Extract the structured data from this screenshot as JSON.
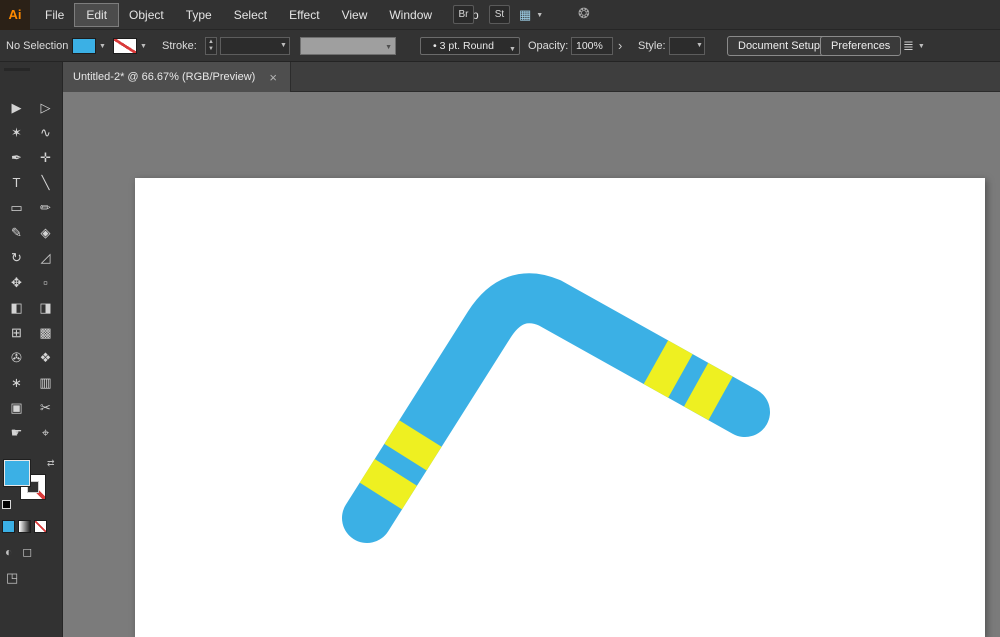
{
  "colors": {
    "panel": "#323232",
    "tab_strip": "#3e3e3e",
    "tab_bg": "#4e4e4e",
    "canvas": "#7b7b7b",
    "artboard": "#ffffff",
    "accent_blue": "#3BB0E5",
    "stripe_yellow": "#EEF021",
    "none_red": "#D93A3A",
    "logo_orange": "#FF8A00"
  },
  "menu": {
    "logo": "Ai",
    "items": [
      "File",
      "Edit",
      "Object",
      "Type",
      "Select",
      "Effect",
      "View",
      "Window",
      "Help"
    ],
    "active_item": "Edit",
    "br_button": "Br",
    "st_button": "St"
  },
  "control": {
    "selection_status": "No Selection",
    "stroke_label": "Stroke:",
    "brush_bullet": "•",
    "brush_value": "3 pt. Round",
    "opacity_label": "Opacity:",
    "opacity_value": "100%",
    "opacity_more": "›",
    "style_label": "Style:",
    "document_setup_button": "Document Setup",
    "preferences_button": "Preferences"
  },
  "tab": {
    "title": "Untitled-2* @ 66.67% (RGB/Preview)",
    "close_glyph": "×"
  },
  "icons": {
    "dropdown": "▼",
    "stepper_up": "▲",
    "stepper_down": "▼",
    "workspace": "▦",
    "extra": "❂",
    "align": "≣",
    "swap": "⇄",
    "draw_mode_a": "◐",
    "draw_mode_b": "◻",
    "screen_mode": "◳"
  },
  "toolbar": {
    "tools": [
      {
        "name": "selection-tool-icon",
        "glyph": "▶"
      },
      {
        "name": "direct-selection-tool-icon",
        "glyph": "▷"
      },
      {
        "name": "magic-wand-tool-icon",
        "glyph": "✶"
      },
      {
        "name": "lasso-tool-icon",
        "glyph": "∿"
      },
      {
        "name": "pen-tool-icon",
        "glyph": "✒"
      },
      {
        "name": "add-anchor-point-tool-icon",
        "glyph": "✛"
      },
      {
        "name": "type-tool-icon",
        "glyph": "T"
      },
      {
        "name": "line-segment-tool-icon",
        "glyph": "╲"
      },
      {
        "name": "rectangle-tool-icon",
        "glyph": "▭"
      },
      {
        "name": "paintbrush-tool-icon",
        "glyph": "✏"
      },
      {
        "name": "pencil-tool-icon",
        "glyph": "✎"
      },
      {
        "name": "shaper-tool-icon",
        "glyph": "◈"
      },
      {
        "name": "rotate-tool-icon",
        "glyph": "↻"
      },
      {
        "name": "scale-tool-icon",
        "glyph": "◿"
      },
      {
        "name": "width-tool-icon",
        "glyph": "✥"
      },
      {
        "name": "free-transform-tool-icon",
        "glyph": "▫"
      },
      {
        "name": "shape-builder-tool-icon",
        "glyph": "◧"
      },
      {
        "name": "perspective-grid-tool-icon",
        "glyph": "◨"
      },
      {
        "name": "mesh-tool-icon",
        "glyph": "⊞"
      },
      {
        "name": "gradient-tool-icon",
        "glyph": "▩"
      },
      {
        "name": "eyedropper-tool-icon",
        "glyph": "✇"
      },
      {
        "name": "blend-tool-icon",
        "glyph": "❖"
      },
      {
        "name": "symbol-sprayer-tool-icon",
        "glyph": "∗"
      },
      {
        "name": "column-graph-tool-icon",
        "glyph": "▥"
      },
      {
        "name": "artboard-tool-icon",
        "glyph": "▣"
      },
      {
        "name": "slice-tool-icon",
        "glyph": "✂"
      },
      {
        "name": "hand-tool-icon",
        "glyph": "☛"
      },
      {
        "name": "zoom-tool-icon",
        "glyph": "⌖"
      }
    ]
  },
  "artwork": {
    "description": "blue boomerang with yellow stripes on white artboard"
  }
}
